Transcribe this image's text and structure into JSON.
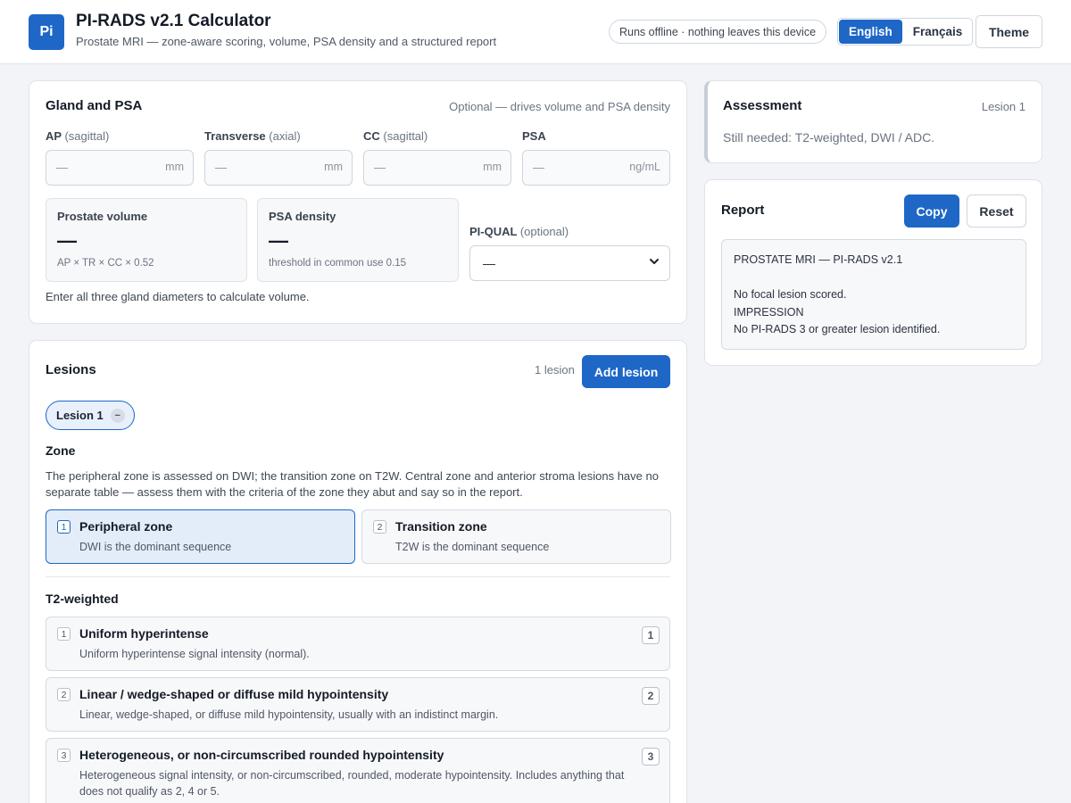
{
  "header": {
    "logo_text": "Pi",
    "title": "PI-RADS v2.1 Calculator",
    "subtitle": "Prostate MRI — zone-aware scoring, volume, PSA density and a structured report",
    "offline_badge": "Runs offline · nothing leaves this device",
    "languages": [
      "English",
      "Français"
    ],
    "active_language": "English",
    "theme_label": "Theme"
  },
  "gland": {
    "title": "Gland and PSA",
    "hint": "Optional — drives volume and PSA density",
    "fields": [
      {
        "label": "AP",
        "sub": "(sagittal)",
        "placeholder": "—",
        "unit": "mm"
      },
      {
        "label": "Transverse",
        "sub": "(axial)",
        "placeholder": "—",
        "unit": "mm"
      },
      {
        "label": "CC",
        "sub": "(sagittal)",
        "placeholder": "—",
        "unit": "mm"
      },
      {
        "label": "PSA",
        "sub": "",
        "placeholder": "—",
        "unit": "ng/mL"
      }
    ],
    "volume": {
      "label": "Prostate volume",
      "value": "—",
      "hint": "AP × TR × CC × 0.52"
    },
    "density": {
      "label": "PSA density",
      "value": "—",
      "hint": "threshold in common use 0.15"
    },
    "piqual": {
      "label": "PI-QUAL",
      "sub": "(optional)",
      "value": "—"
    },
    "message": "Enter all three gland diameters to calculate volume."
  },
  "lesions": {
    "title": "Lesions",
    "count": "1 lesion",
    "add_label": "Add lesion",
    "chip_label": "Lesion 1",
    "chip_remove": "−",
    "zone_heading": "Zone",
    "zone_description": "The peripheral zone is assessed on DWI; the transition zone on T2W. Central zone and anterior stroma lesions have no separate table — assess them with the criteria of the zone they abut and say so in the report.",
    "zones": [
      {
        "key": "1",
        "title": "Peripheral zone",
        "desc": "DWI is the dominant sequence",
        "selected": true
      },
      {
        "key": "2",
        "title": "Transition zone",
        "desc": "T2W is the dominant sequence",
        "selected": false
      }
    ],
    "t2_heading": "T2-weighted",
    "t2_options": [
      {
        "key": "1",
        "title": "Uniform hyperintense",
        "desc": "Uniform hyperintense signal intensity (normal).",
        "score": "1"
      },
      {
        "key": "2",
        "title": "Linear / wedge-shaped or diffuse mild hypointensity",
        "desc": "Linear, wedge-shaped, or diffuse mild hypointensity, usually with an indistinct margin.",
        "score": "2"
      },
      {
        "key": "3",
        "title": "Heterogeneous, or non-circumscribed rounded hypointensity",
        "desc": "Heterogeneous signal intensity, or non-circumscribed, rounded, moderate hypointensity. Includes anything that does not qualify as 2, 4 or 5.",
        "score": "3"
      }
    ]
  },
  "assessment": {
    "title": "Assessment",
    "lesion": "Lesion 1",
    "status": "Still needed: T2-weighted, DWI / ADC."
  },
  "report": {
    "title": "Report",
    "copy_label": "Copy",
    "reset_label": "Reset",
    "lines": [
      "PROSTATE MRI — PI-RADS v2.1",
      "",
      "No focal lesion scored.",
      "IMPRESSION",
      "No PI-RADS 3 or greater lesion identified."
    ]
  },
  "colors": {
    "accent": "#1e67c7",
    "background": "#f2f4f7"
  }
}
